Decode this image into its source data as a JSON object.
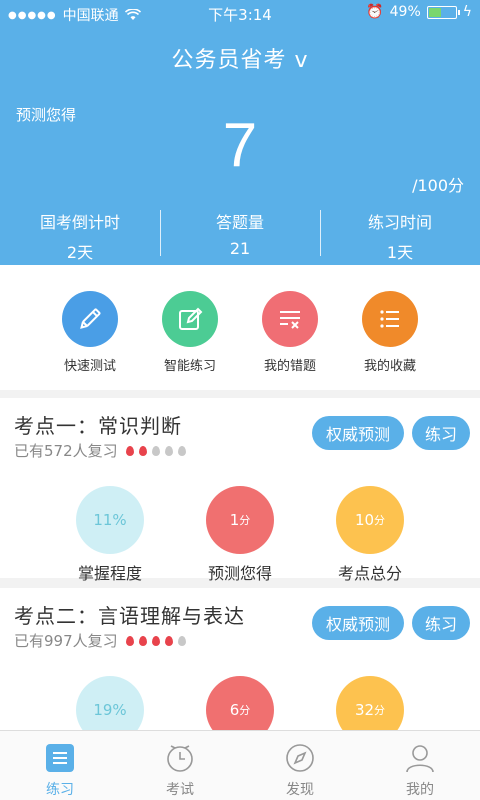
{
  "status_bar": {
    "carrier": "中国联通",
    "time": "下午3:14",
    "battery": "49%",
    "battery_level": 0.49
  },
  "header": {
    "title": "公务员省考 v",
    "predict_label": "预测您得",
    "score": "7",
    "total": "/100分",
    "stats": [
      {
        "label": "国考倒计时",
        "value": "2天"
      },
      {
        "label": "答题量",
        "value": "21"
      },
      {
        "label": "练习时间",
        "value": "1天"
      }
    ]
  },
  "actions": [
    {
      "label": "快速测试",
      "icon": "pencil-icon",
      "color": "#4a9ee6"
    },
    {
      "label": "智能练习",
      "icon": "edit-icon",
      "color": "#4ccc94"
    },
    {
      "label": "我的错题",
      "icon": "wrong-list-icon",
      "color": "#f06e74"
    },
    {
      "label": "我的收藏",
      "icon": "favorites-list-icon",
      "color": "#f08a2a"
    }
  ],
  "topics": [
    {
      "title": "考点一：常识判断",
      "reviewers": "已有572人复习",
      "difficulty": 2,
      "predict_btn": "权威预测",
      "practice_btn": "练习",
      "metrics": [
        {
          "value": "11%",
          "unit": "",
          "label": "掌握程度",
          "color": "#cfeff5",
          "text_color": "#6cc6d8"
        },
        {
          "value": "1",
          "unit": "分",
          "label": "预测您得",
          "color": "#f07070",
          "text_color": "#ffffff"
        },
        {
          "value": "10",
          "unit": "分",
          "label": "考点总分",
          "color": "#fdc24f",
          "text_color": "#ffffff"
        }
      ]
    },
    {
      "title": "考点二：言语理解与表达",
      "reviewers": "已有997人复习",
      "difficulty": 4,
      "predict_btn": "权威预测",
      "practice_btn": "练习",
      "metrics": [
        {
          "value": "19%",
          "unit": "",
          "label": "",
          "color": "#cfeff5",
          "text_color": "#6cc6d8"
        },
        {
          "value": "6",
          "unit": "分",
          "label": "",
          "color": "#f07070",
          "text_color": "#ffffff"
        },
        {
          "value": "32",
          "unit": "分",
          "label": "",
          "color": "#fdc24f",
          "text_color": "#ffffff"
        }
      ]
    }
  ],
  "tabs": [
    {
      "label": "练习",
      "icon": "list-icon",
      "active": true
    },
    {
      "label": "考试",
      "icon": "clock-icon",
      "active": false
    },
    {
      "label": "发现",
      "icon": "compass-icon",
      "active": false
    },
    {
      "label": "我的",
      "icon": "user-icon",
      "active": false
    }
  ],
  "colors": {
    "primary": "#5ab0e8",
    "drop_active": "#e8434c",
    "drop_inactive": "#c8c8c8"
  }
}
